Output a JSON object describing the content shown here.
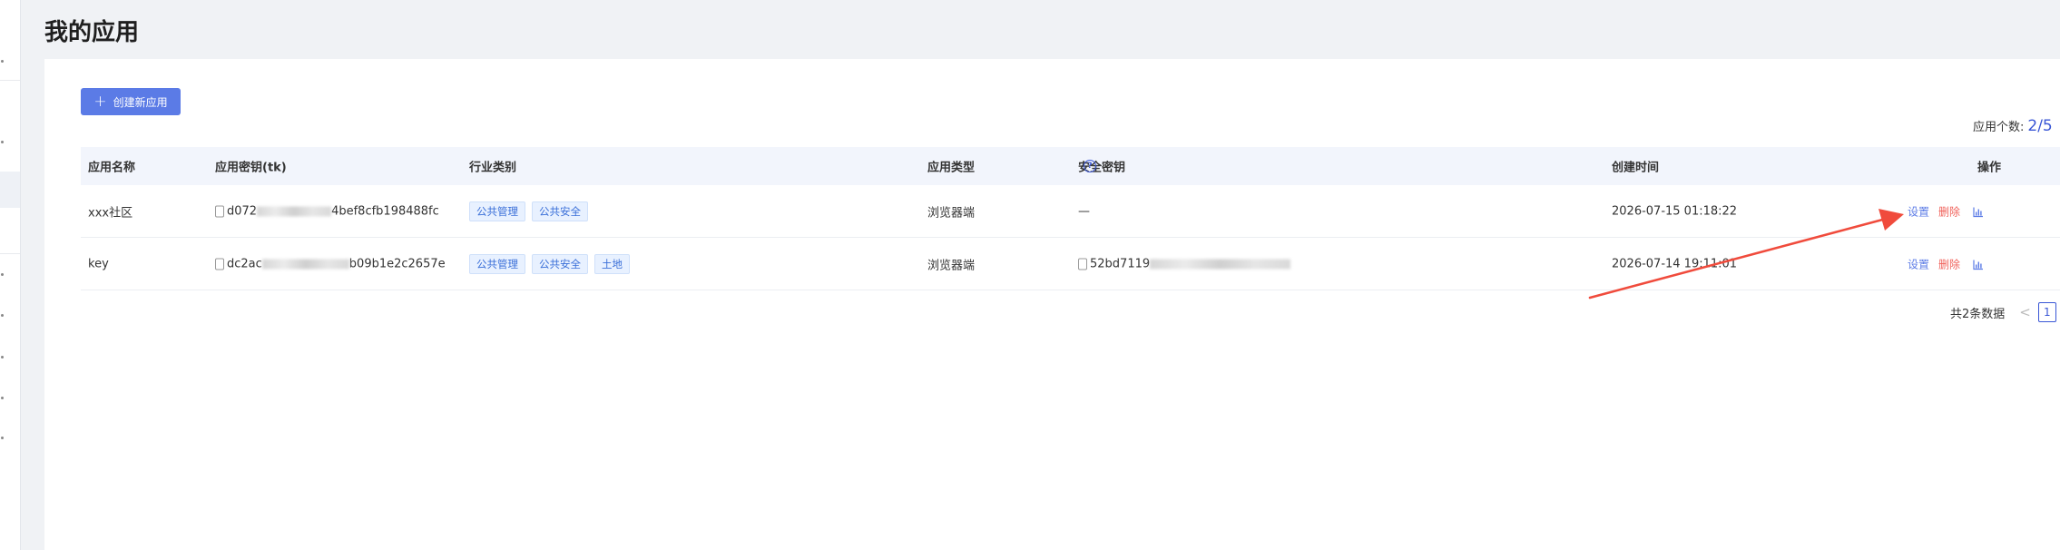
{
  "page": {
    "title": "我的应用"
  },
  "toolbar": {
    "create_label": "创建新应用"
  },
  "app_count": {
    "label": "应用个数:",
    "value": "2/5"
  },
  "table": {
    "headers": {
      "name": "应用名称",
      "key": "应用密钥(tk)",
      "industry": "行业类别",
      "type": "应用类型",
      "secret": "安全密钥",
      "created": "创建时间",
      "ops": "操作"
    },
    "rows": [
      {
        "name": "xxx社区",
        "key_prefix": "d072",
        "key_suffix": "4bef8cfb198488fc",
        "tags": [
          "公共管理",
          "公共安全"
        ],
        "type": "浏览器端",
        "secret": "—",
        "created": "2026-07-15 01:18:22",
        "op_set": "设置",
        "op_delete": "删除"
      },
      {
        "name": "key",
        "key_prefix": "dc2ac",
        "key_suffix": "b09b1e2c2657e",
        "tags": [
          "公共管理",
          "公共安全",
          "土地"
        ],
        "type": "浏览器端",
        "secret": "52bd7119",
        "created": "2026-07-14 19:11:01",
        "op_set": "设置",
        "op_delete": "删除"
      }
    ]
  },
  "pagination": {
    "total": "共2条数据",
    "prev": "<",
    "page": "1"
  },
  "colors": {
    "primary": "#5b7be6",
    "danger": "#f0625b",
    "annotation_arrow": "#f04b3c"
  },
  "icons": [
    "plus-icon",
    "help-icon",
    "copy-icon",
    "bar-chart-icon",
    "annotation-arrow"
  ]
}
